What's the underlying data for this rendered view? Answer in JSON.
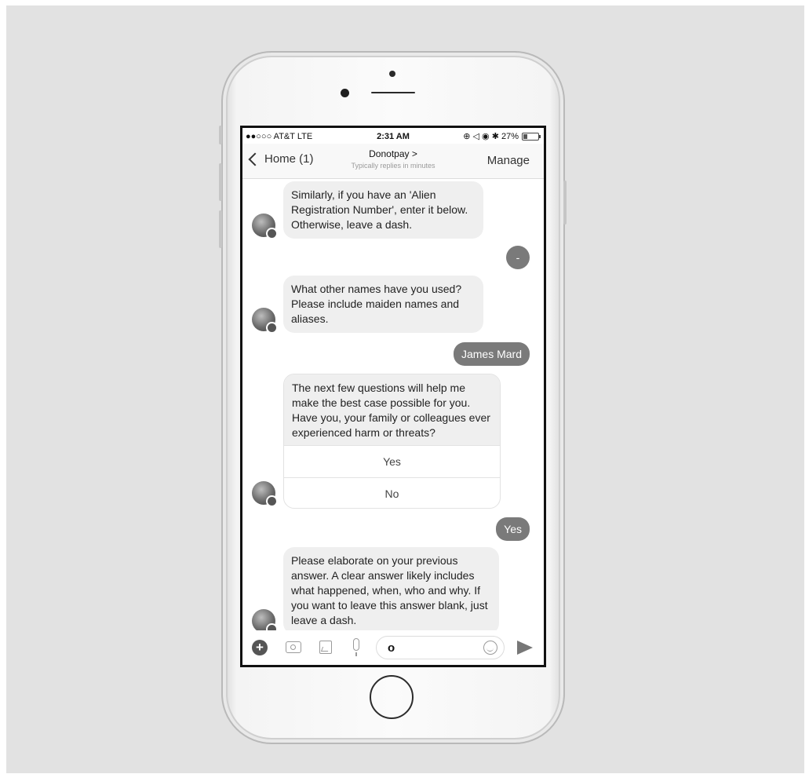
{
  "status_bar": {
    "carrier": "●●○○○ AT&T  LTE",
    "time": "2:31 AM",
    "right_icons": "⊕ ◁ ◉ ✱ 27%"
  },
  "nav": {
    "back_label": "Home (1)",
    "title": "Donotpay >",
    "subtitle": "Typically replies in minutes",
    "manage_label": "Manage"
  },
  "messages": {
    "m1": "Similarly, if you have an 'Alien Registration Number', enter it below. Otherwise, leave a dash.",
    "r1": "-",
    "m2": "What other names have you used? Please include maiden names and aliases.",
    "r2": "James Mard",
    "m3": "The next few questions will help me make the best case possible for you. Have you, your family or colleagues ever experienced harm or threats?",
    "quick_yes": "Yes",
    "quick_no": "No",
    "r3": "Yes",
    "m4": "Please elaborate on your previous answer. A clear answer likely includes what happened, when, who and why. If you want to leave this answer blank, just leave a dash."
  },
  "composer": {
    "input_value": "o"
  },
  "icons": {
    "plus": "plus-icon",
    "camera": "camera-icon",
    "gallery": "image-icon",
    "mic": "microphone-icon",
    "emoji": "emoji-icon",
    "send": "send-icon"
  }
}
